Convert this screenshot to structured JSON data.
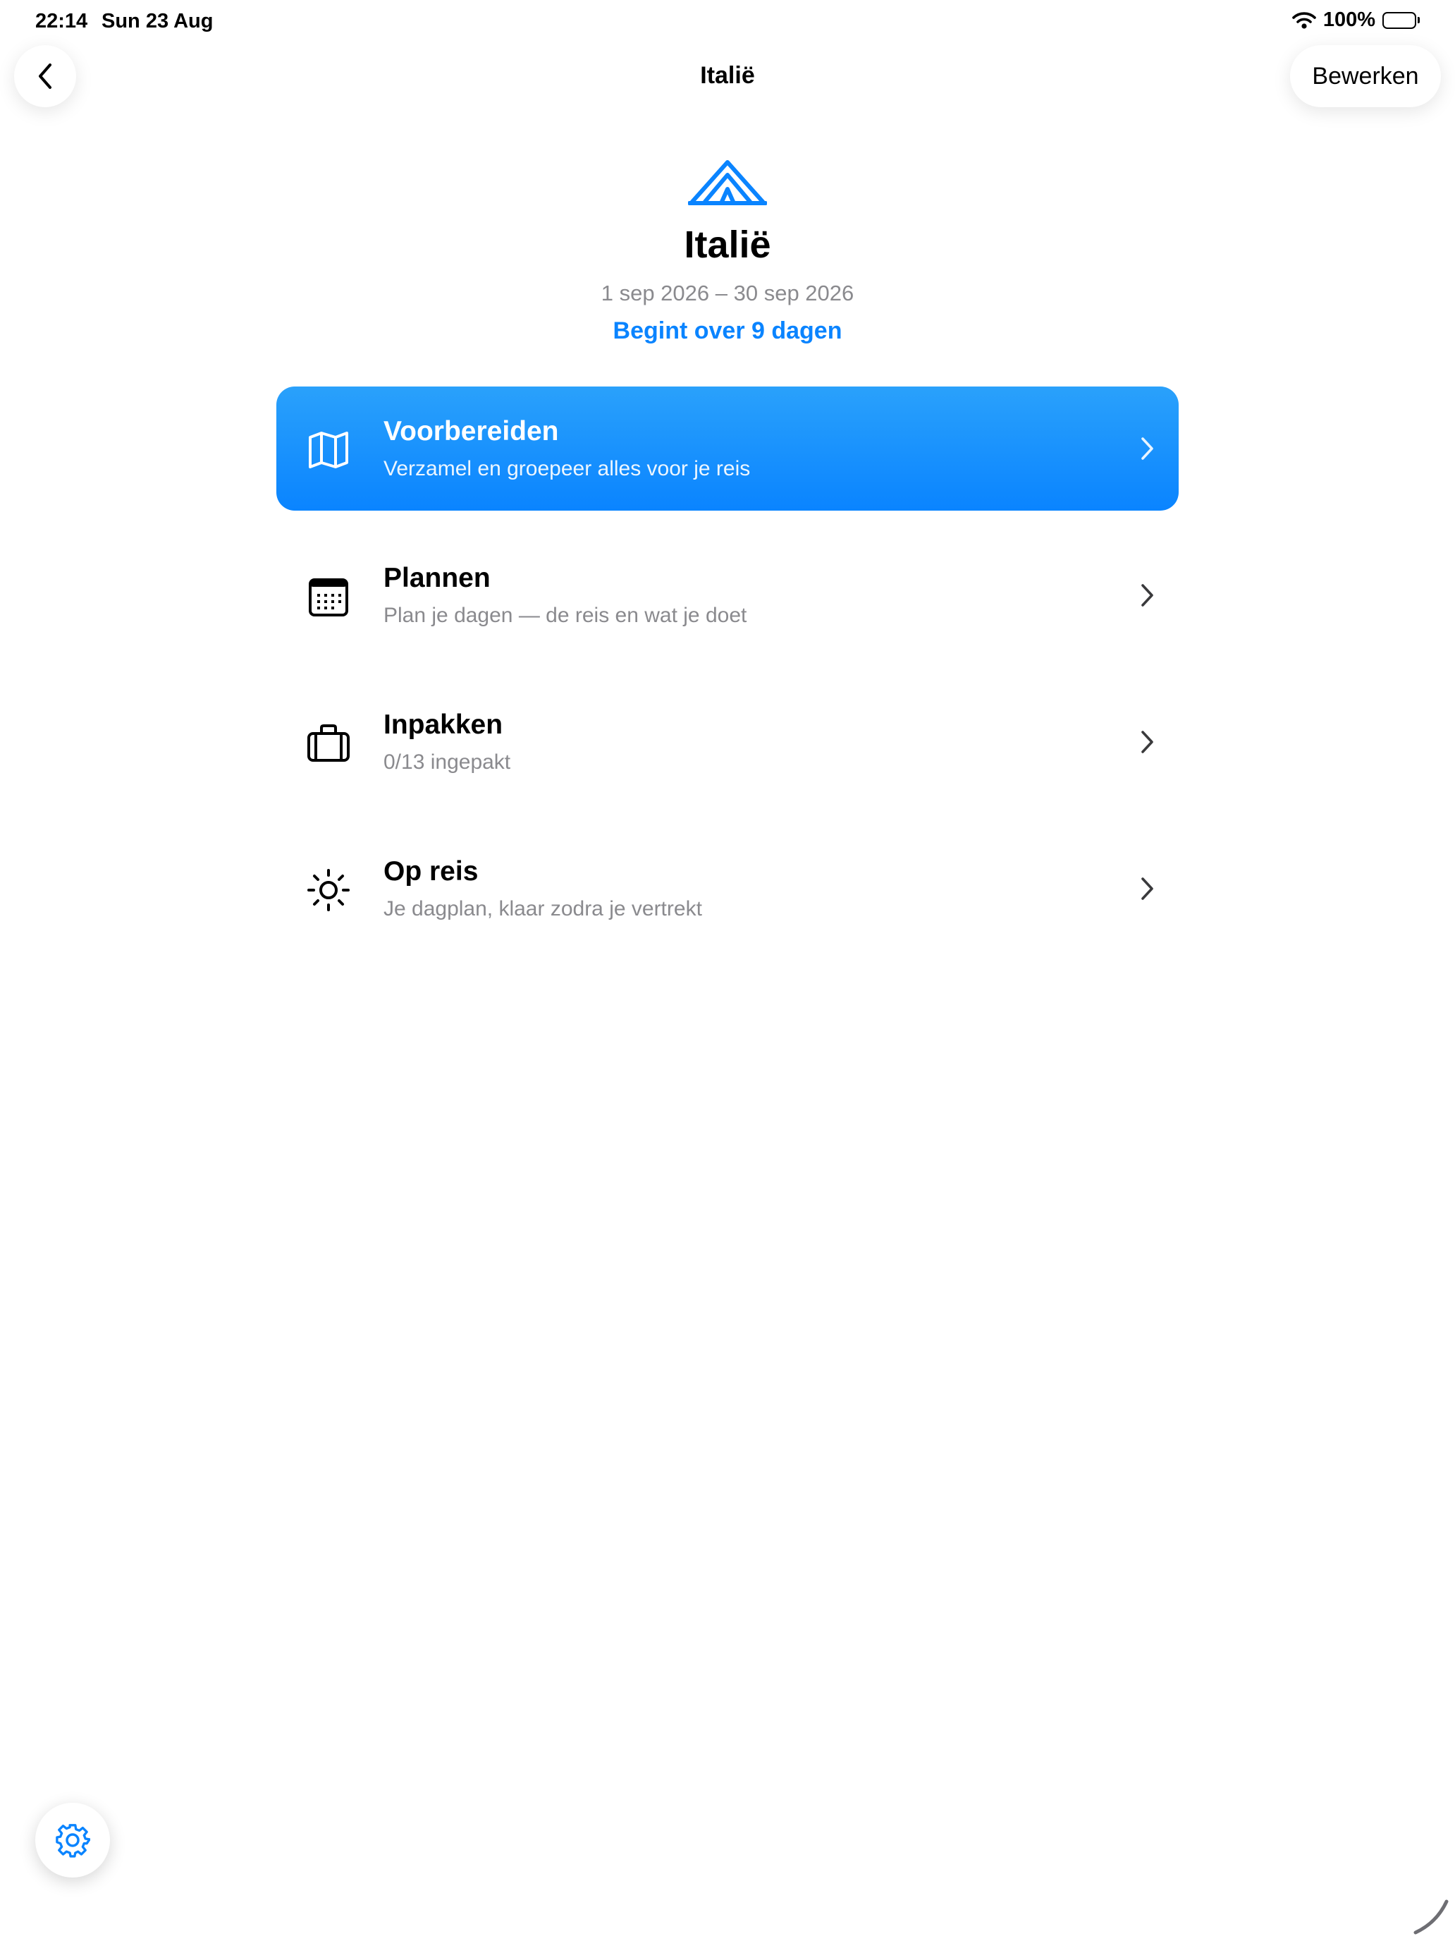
{
  "status_bar": {
    "time": "22:14",
    "date": "Sun 23 Aug",
    "battery": "100%"
  },
  "nav": {
    "title": "Italië",
    "edit_label": "Bewerken"
  },
  "trip": {
    "icon": "tent-icon",
    "title": "Italië",
    "dates": "1 sep 2026 – 30 sep 2026",
    "countdown": "Begint over 9 dagen"
  },
  "menu": [
    {
      "icon": "map-icon",
      "title": "Voorbereiden",
      "subtitle": "Verzamel en groepeer alles voor je reis",
      "active": true
    },
    {
      "icon": "calendar-icon",
      "title": "Plannen",
      "subtitle": "Plan je dagen — de reis en wat je doet",
      "active": false
    },
    {
      "icon": "suitcase-icon",
      "title": "Inpakken",
      "subtitle": "0/13 ingepakt",
      "active": false
    },
    {
      "icon": "sun-icon",
      "title": "Op reis",
      "subtitle": "Je dagplan, klaar zodra je vertrekt",
      "active": false
    }
  ],
  "colors": {
    "accent": "#0a84ff",
    "secondary_text": "#8a8a8e"
  }
}
